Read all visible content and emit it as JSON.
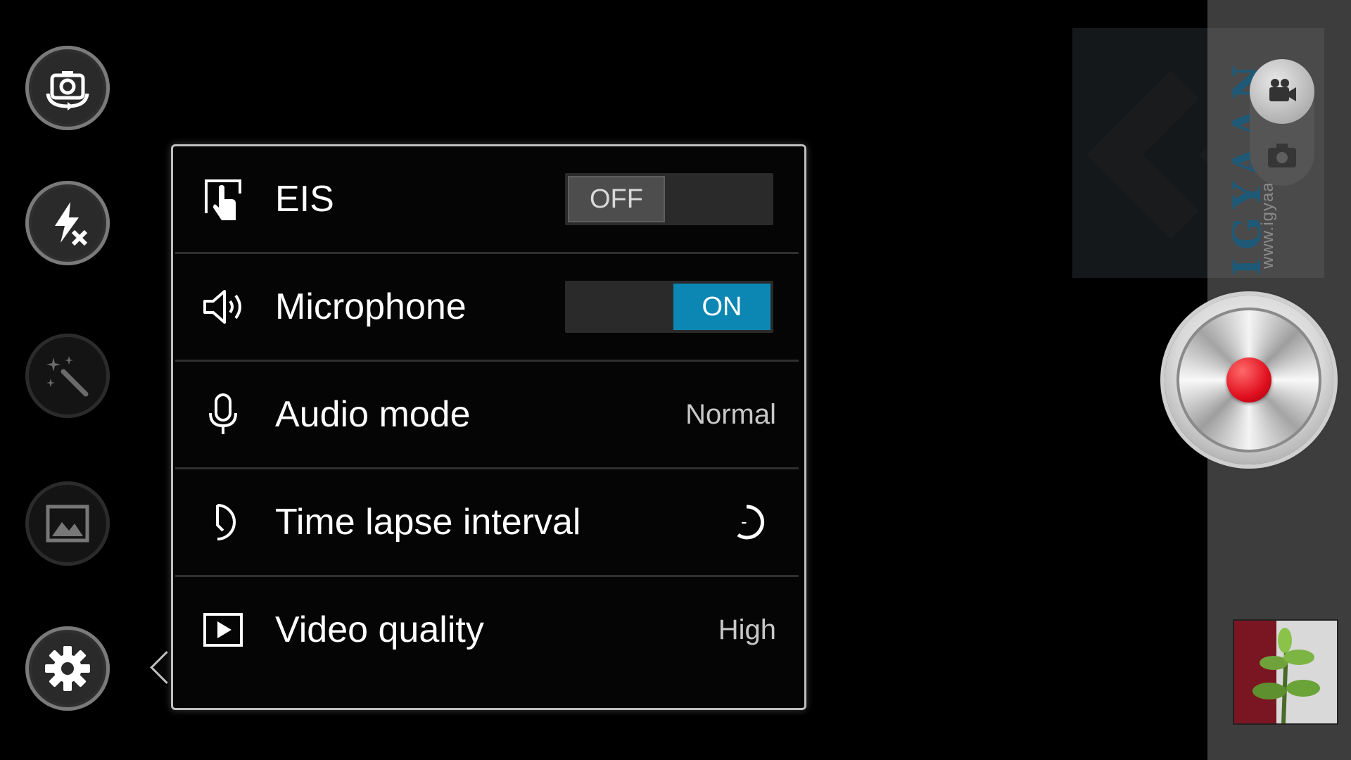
{
  "left_controls": [
    {
      "name": "switch-camera-icon"
    },
    {
      "name": "flash-off-icon"
    },
    {
      "name": "effects-icon"
    },
    {
      "name": "gallery-icon"
    },
    {
      "name": "settings-icon"
    }
  ],
  "settings": {
    "eis": {
      "label": "EIS",
      "toggle": "OFF",
      "icon": "eis-icon"
    },
    "microphone": {
      "label": "Microphone",
      "toggle": "ON",
      "icon": "speaker-icon"
    },
    "audio_mode": {
      "label": "Audio mode",
      "value": "Normal",
      "icon": "microphone-icon"
    },
    "time_lapse": {
      "label": "Time lapse interval",
      "value": "-",
      "icon": "timer-icon"
    },
    "video_quality": {
      "label": "Video quality",
      "value": "High",
      "icon": "video-quality-icon"
    }
  },
  "watermark": {
    "brand": "IGYAAN",
    "url": "www.igyaan.in"
  },
  "colors": {
    "toggle_on": "#0c87b3",
    "record": "#e0101f",
    "panel_border": "#bfbfbf"
  }
}
